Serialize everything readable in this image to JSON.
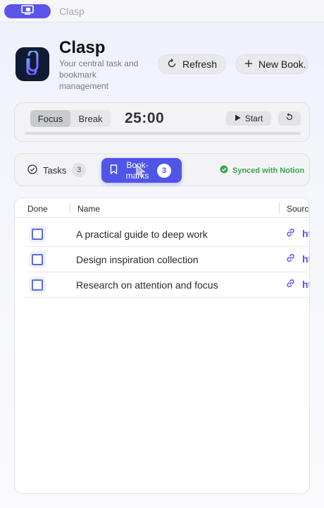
{
  "window": {
    "title": "Clasp"
  },
  "header": {
    "app_name": "Clasp",
    "description": "Your central task and bookmark management",
    "refresh_label": "Refresh",
    "new_bookmark_label": "New Book..."
  },
  "timer": {
    "modes": [
      "Focus",
      "Break"
    ],
    "active_mode": "Focus",
    "time": "25:00",
    "start_label": "Start",
    "progress": 0.0
  },
  "tabs": {
    "tasks": {
      "label": "Tasks",
      "count": "3"
    },
    "bookmarks": {
      "label": "Book-marks",
      "count": "3",
      "active": true
    }
  },
  "sync_status": "Synced with Notion",
  "table": {
    "columns": [
      "Done",
      "Name",
      "Source"
    ],
    "rows": [
      {
        "done": false,
        "name": "A practical guide to deep work",
        "source": "ht"
      },
      {
        "done": false,
        "name": "Design inspiration collection",
        "source": "ht"
      },
      {
        "done": false,
        "name": "Research on attention and focus",
        "source": "ht"
      }
    ]
  },
  "colors": {
    "accent": "#4f55e8",
    "success": "#34a853",
    "logo_bg": "#101a33"
  }
}
